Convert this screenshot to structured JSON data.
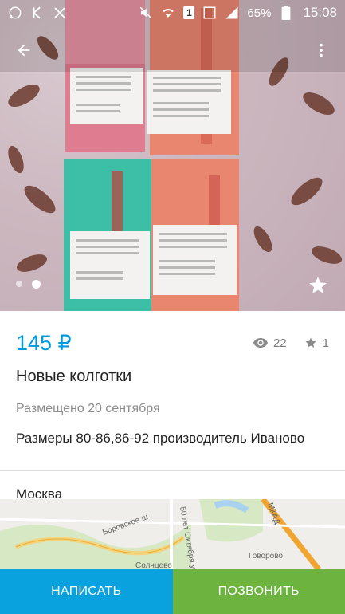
{
  "status_bar": {
    "battery": "65%",
    "time": "15:08",
    "sim_badge": "1",
    "icons": [
      "whatsapp-icon",
      "k-app-icon",
      "close-app-icon",
      "mute-icon",
      "wifi-icon",
      "sim-icon",
      "screen-icon",
      "signal-icon",
      "battery-icon"
    ]
  },
  "gallery": {
    "current_index": 2,
    "total": 2
  },
  "listing": {
    "price": "145 ₽",
    "views": "22",
    "favorites": "1",
    "title": "Новые колготки",
    "posted": "Размещено 20 сентября",
    "description": "Размеры 80-86,86-92 производитель Иваново",
    "city": "Москва"
  },
  "map": {
    "labels": {
      "road1": "Боровское ш.",
      "road2": "50 лет Октября ул.",
      "road3": "МКАД",
      "district": "Говорово",
      "street": "Солнцево"
    }
  },
  "actions": {
    "write_label": "НАПИСАТЬ",
    "call_label": "ПОЗВОНИТЬ"
  },
  "colors": {
    "price": "#0098dc",
    "write_button": "#0aa1df",
    "call_button": "#6db33f"
  }
}
